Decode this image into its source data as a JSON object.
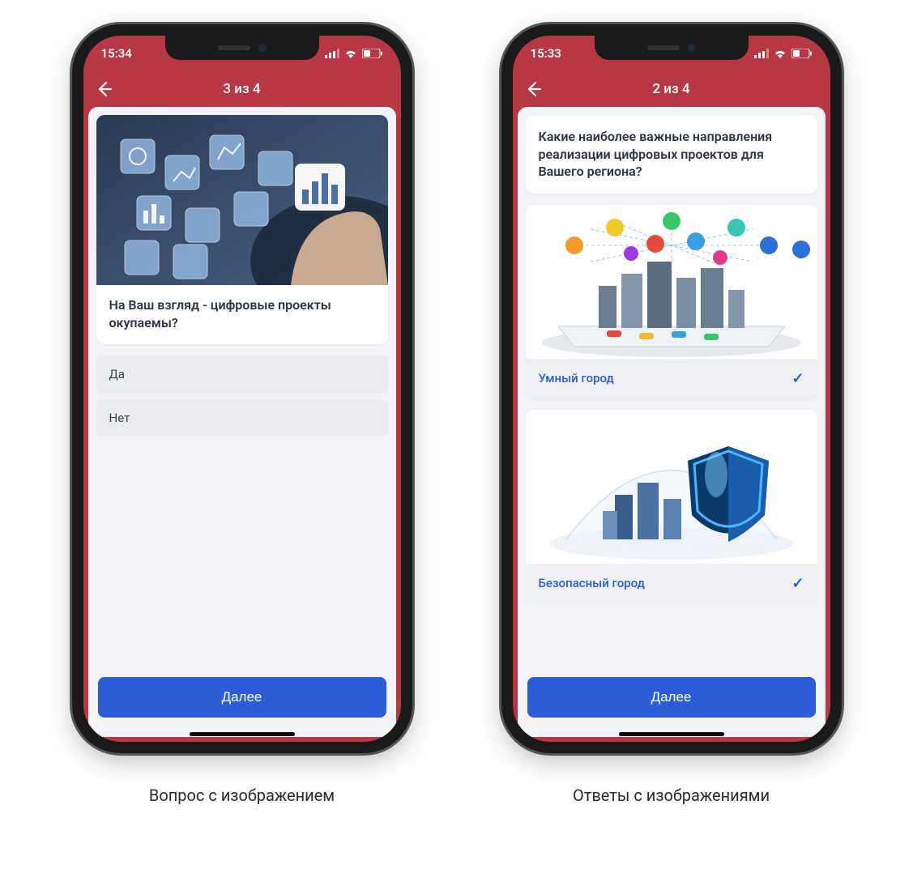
{
  "phones": [
    {
      "status_time": "15:34",
      "header_title": "3 из 4",
      "question": "На Ваш взгляд - цифровые проекты окупаемы?",
      "answers": [
        "Да",
        "Нет"
      ],
      "next_button": "Далее"
    },
    {
      "status_time": "15:33",
      "header_title": "2 из 4",
      "question": "Какие наиболее важные направления реализации цифровых проектов для Вашего региона?",
      "image_answers": [
        {
          "label": "Умный город",
          "selected": true
        },
        {
          "label": "Безопасный город",
          "selected": true
        }
      ],
      "next_button": "Далее"
    }
  ],
  "captions": [
    "Вопрос с изображением",
    "Ответы с изображениями"
  ]
}
